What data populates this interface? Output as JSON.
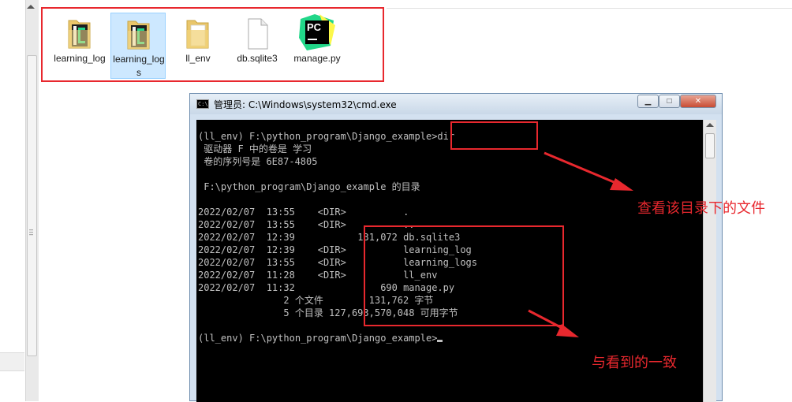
{
  "files": [
    {
      "name": "learning_log",
      "icon": "pycharm-folder-icon"
    },
    {
      "name": "learning_logs",
      "icon": "pycharm-folder-icon",
      "selected": true
    },
    {
      "name": "ll_env",
      "icon": "folder-icon"
    },
    {
      "name": "db.sqlite3",
      "icon": "file-icon"
    },
    {
      "name": "manage.py",
      "icon": "pycharm-file-icon"
    }
  ],
  "pycharm_badge": "PC",
  "cmd": {
    "title": "管理员: C:\\Windows\\system32\\cmd.exe",
    "icon_text": "C:\\",
    "lines": [
      "(ll_env) F:\\python_program\\Django_example>dir",
      " 驱动器 F 中的卷是 学习",
      " 卷的序列号是 6E87-4805",
      "",
      " F:\\python_program\\Django_example 的目录",
      "",
      "2022/02/07  13:55    <DIR>          .",
      "2022/02/07  13:55    <DIR>          ..",
      "2022/02/07  12:39           131,072 db.sqlite3",
      "2022/02/07  12:39    <DIR>          learning_log",
      "2022/02/07  13:55    <DIR>          learning_logs",
      "2022/02/07  11:28    <DIR>          ll_env",
      "2022/02/07  11:32               690 manage.py",
      "               2 个文件        131,762 字节",
      "               5 个目录 127,693,570,048 可用字节",
      "",
      "(ll_env) F:\\python_program\\Django_example>"
    ]
  },
  "annotations": {
    "view_files": "查看该目录下的文件",
    "consistent": "与看到的一致"
  },
  "colors": {
    "annotation_red": "#e8282e",
    "console_bg": "#000000",
    "console_text": "#c0c0c0",
    "selection": "#cde8ff"
  }
}
